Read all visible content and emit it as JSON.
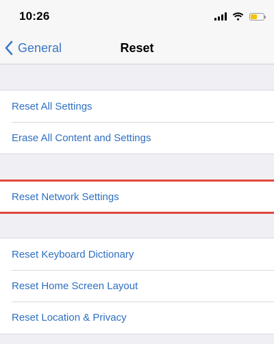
{
  "status_bar": {
    "time": "10:26",
    "icons": [
      "cellular-signal-icon",
      "wifi-icon",
      "battery-icon"
    ],
    "battery_color": "#f5c400"
  },
  "nav": {
    "back_label": "General",
    "title": "Reset"
  },
  "groups": [
    {
      "items": [
        {
          "label": "Reset All Settings"
        },
        {
          "label": "Erase All Content and Settings"
        }
      ]
    },
    {
      "items": [
        {
          "label": "Reset Network Settings",
          "highlighted": true
        }
      ]
    },
    {
      "items": [
        {
          "label": "Reset Keyboard Dictionary"
        },
        {
          "label": "Reset Home Screen Layout"
        },
        {
          "label": "Reset Location & Privacy"
        }
      ]
    }
  ],
  "colors": {
    "link": "#2e6fc1",
    "highlight_border": "#e0473a",
    "background": "#efeff4"
  }
}
